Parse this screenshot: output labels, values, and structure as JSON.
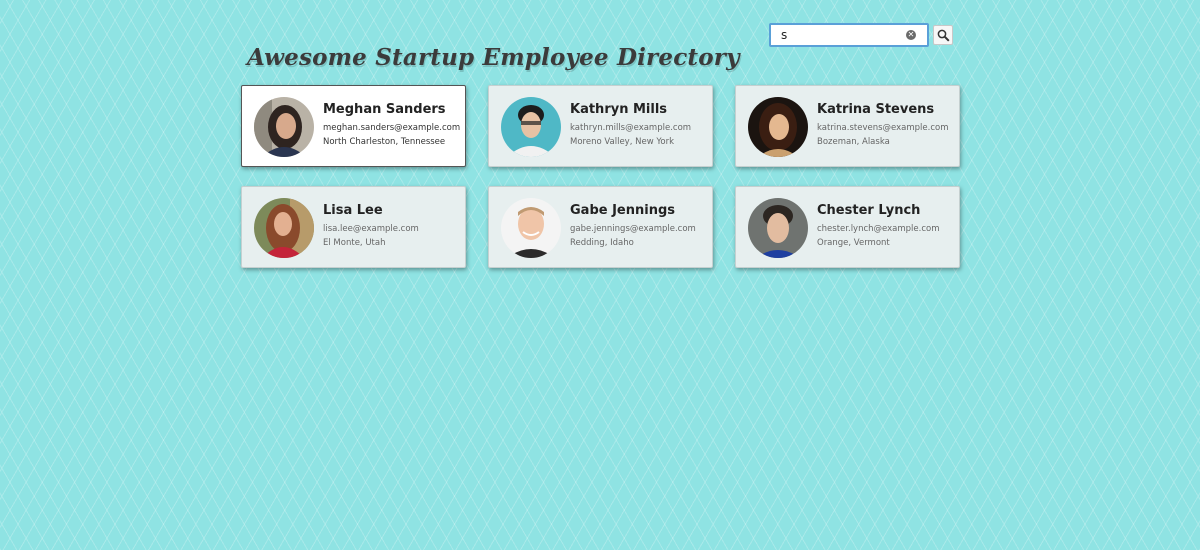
{
  "header": {
    "title": "Awesome Startup Employee Directory"
  },
  "search": {
    "value": "s",
    "clear_icon": "clear-icon",
    "button_icon": "magnifier-icon"
  },
  "employees": [
    {
      "name": "Meghan Sanders",
      "email": "meghan.sanders@example.com",
      "location": "North Charleston, Tennessee",
      "selected": true
    },
    {
      "name": "Kathryn Mills",
      "email": "kathryn.mills@example.com",
      "location": "Moreno Valley, New York",
      "selected": false
    },
    {
      "name": "Katrina Stevens",
      "email": "katrina.stevens@example.com",
      "location": "Bozeman, Alaska",
      "selected": false
    },
    {
      "name": "Lisa Lee",
      "email": "lisa.lee@example.com",
      "location": "El Monte, Utah",
      "selected": false
    },
    {
      "name": "Gabe Jennings",
      "email": "gabe.jennings@example.com",
      "location": "Redding, Idaho",
      "selected": false
    },
    {
      "name": "Chester Lynch",
      "email": "chester.lynch@example.com",
      "location": "Orange, Vermont",
      "selected": false
    }
  ],
  "colors": {
    "background": "#8fe3e3",
    "card": "#e7efef",
    "selected_card": "#ffffff",
    "search_border": "#5aa0d8"
  }
}
